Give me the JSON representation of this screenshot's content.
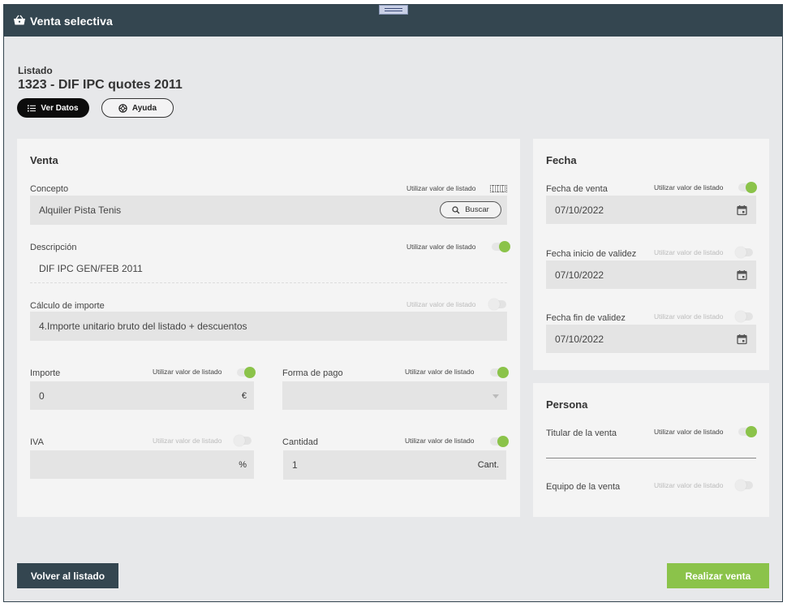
{
  "window": {
    "title": "Venta selectiva",
    "title_icon": "basket-icon"
  },
  "header": {
    "caption": "Listado",
    "title": "1323 - DIF IPC quotes 2011",
    "ver_datos_label": "Ver Datos",
    "ayuda_label": "Ayuda"
  },
  "venta": {
    "title": "Venta",
    "use_list_label": "Utilizar valor de listado",
    "concepto": {
      "label": "Concepto",
      "value": "Alquiler Pista Tenis",
      "search_label": "Buscar",
      "use_list": null
    },
    "descripcion": {
      "label": "Descripción",
      "value": "DIF IPC GEN/FEB 2011",
      "use_list": true
    },
    "calculo": {
      "label": "Cálculo de importe",
      "value": "4.Importe unitario bruto del listado + descuentos",
      "use_list": false
    },
    "importe": {
      "label": "Importe",
      "value": "0",
      "unit": "€",
      "use_list": true
    },
    "forma_pago": {
      "label": "Forma de pago",
      "value": "",
      "use_list": true
    },
    "iva": {
      "label": "IVA",
      "value": "",
      "unit": "%",
      "use_list": false
    },
    "cantidad": {
      "label": "Cantidad",
      "value": "1",
      "unit": "Cant.",
      "use_list": true
    }
  },
  "fecha": {
    "title": "Fecha",
    "fecha_venta": {
      "label": "Fecha de venta",
      "value": "07/10/2022",
      "use_list": true
    },
    "fecha_inicio": {
      "label": "Fecha inicio de validez",
      "value": "07/10/2022",
      "use_list": false
    },
    "fecha_fin": {
      "label": "Fecha fin de validez",
      "value": "07/10/2022",
      "use_list": false
    }
  },
  "persona": {
    "title": "Persona",
    "titular": {
      "label": "Titular de la venta",
      "value": "",
      "use_list": true
    },
    "equipo": {
      "label": "Equipo de la venta",
      "use_list": false
    }
  },
  "footer": {
    "back_label": "Volver al listado",
    "submit_label": "Realizar venta"
  },
  "colors": {
    "header_bg": "#344650",
    "accent_green": "#8bc34a",
    "background": "#e7e8ea",
    "card": "#f4f4f4",
    "field": "#e4e4e4"
  }
}
